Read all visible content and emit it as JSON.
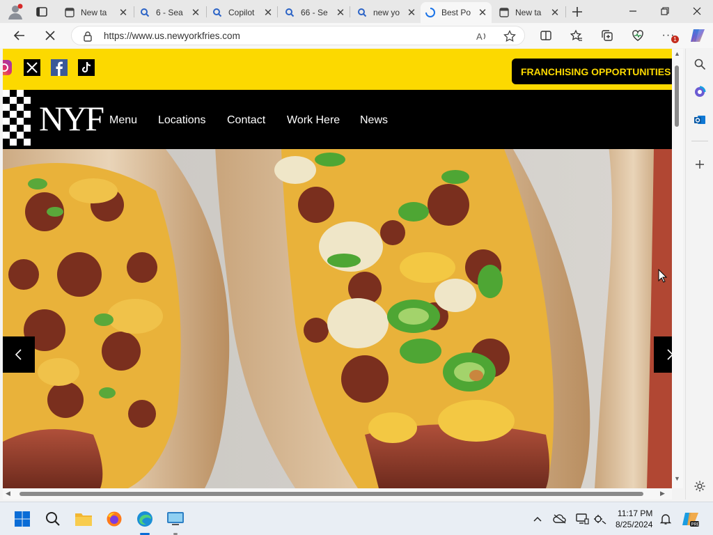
{
  "browser": {
    "tabs": [
      {
        "title": "New ta",
        "icon": "new-tab-icon"
      },
      {
        "title": "6 - Sea",
        "icon": "search-icon"
      },
      {
        "title": "Copilot",
        "icon": "search-icon"
      },
      {
        "title": "66 - Se",
        "icon": "search-icon"
      },
      {
        "title": "new yo",
        "icon": "search-icon"
      },
      {
        "title": "Best Po",
        "icon": "edge-loading-icon",
        "active": true
      },
      {
        "title": "New ta",
        "icon": "new-tab-icon"
      }
    ],
    "url": "https://www.us.newyorkfries.com",
    "extension_badge": "1"
  },
  "site": {
    "franchise_label": "FRANCHISING OPPORTUNITIES",
    "logo_text": "NYF",
    "nav": [
      {
        "label": "Menu"
      },
      {
        "label": "Locations"
      },
      {
        "label": "Contact"
      },
      {
        "label": "Work Here"
      },
      {
        "label": "News"
      }
    ],
    "colors": {
      "accent": "#fcd900",
      "dark": "#000000"
    }
  },
  "taskbar": {
    "time": "11:17 PM",
    "date": "8/25/2024"
  }
}
